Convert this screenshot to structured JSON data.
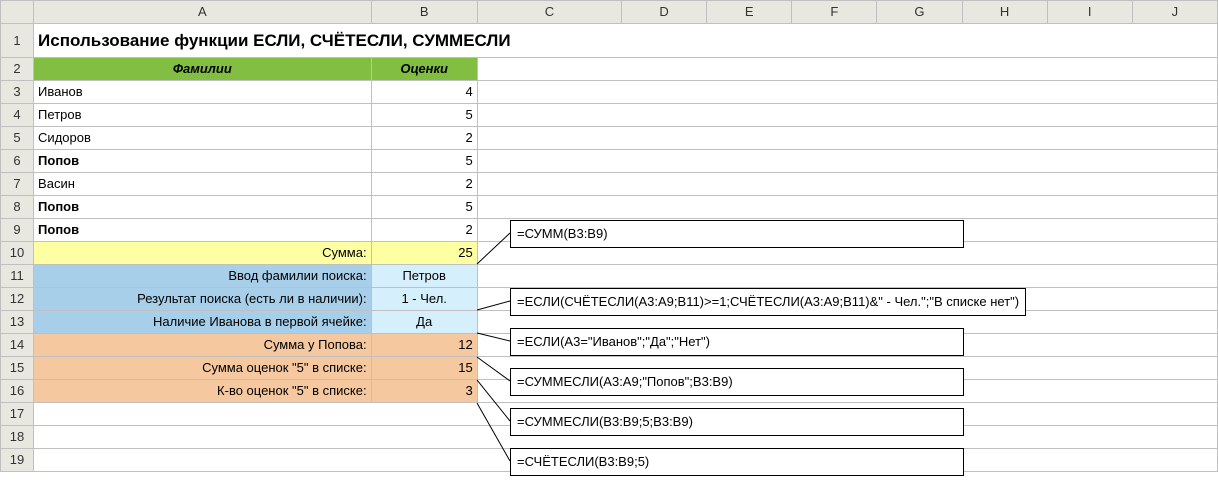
{
  "columns": [
    "",
    "A",
    "B",
    "C",
    "D",
    "E",
    "F",
    "G",
    "H",
    "I",
    "J"
  ],
  "rows": [
    "1",
    "2",
    "3",
    "4",
    "5",
    "6",
    "7",
    "8",
    "9",
    "10",
    "11",
    "12",
    "13",
    "14",
    "15",
    "16",
    "17",
    "18",
    "19"
  ],
  "title": "Использование функции ЕСЛИ, СЧЁТЕСЛИ, СУММЕСЛИ",
  "headers": {
    "a": "Фамилии",
    "b": "Оценки"
  },
  "names": [
    {
      "a": "Иванов",
      "b": "4",
      "bold": false
    },
    {
      "a": "Петров",
      "b": "5",
      "bold": false
    },
    {
      "a": "Сидоров",
      "b": "2",
      "bold": false
    },
    {
      "a": "Попов",
      "b": "5",
      "bold": true
    },
    {
      "a": "Васин",
      "b": "2",
      "bold": false
    },
    {
      "a": "Попов",
      "b": "5",
      "bold": true
    },
    {
      "a": "Попов",
      "b": "2",
      "bold": true
    }
  ],
  "sum": {
    "label": "Сумма:",
    "value": "25"
  },
  "search_input": {
    "label": "Ввод фамилии поиска:",
    "value": "Петров"
  },
  "search_result": {
    "label": "Результат поиска (есть ли в наличии):",
    "value": "1 - Чел."
  },
  "ivanov_check": {
    "label": "Наличие Иванова в первой ячейке:",
    "value": "Да"
  },
  "popov_sum": {
    "label": "Сумма у Попова:",
    "value": "12"
  },
  "sum_fives": {
    "label": "Сумма оценок \"5\" в списке:",
    "value": "15"
  },
  "count_fives": {
    "label": "К-во оценок \"5\" в списке:",
    "value": "3"
  },
  "callouts": {
    "c1": "=СУММ(B3:B9)",
    "c2": "=ЕСЛИ(СЧЁТЕСЛИ(A3:A9;B11)>=1;СЧЁТЕСЛИ(A3:A9;B11)&\" - Чел.\";\"В списке нет\")",
    "c3": "=ЕСЛИ(A3=\"Иванов\";\"Да\";\"Нет\")",
    "c4": "=СУММЕСЛИ(A3:A9;\"Попов\";B3:B9)",
    "c5": "=СУММЕСЛИ(B3:B9;5;B3:B9)",
    "c6": "=СЧЁТЕСЛИ(B3:B9;5)"
  }
}
